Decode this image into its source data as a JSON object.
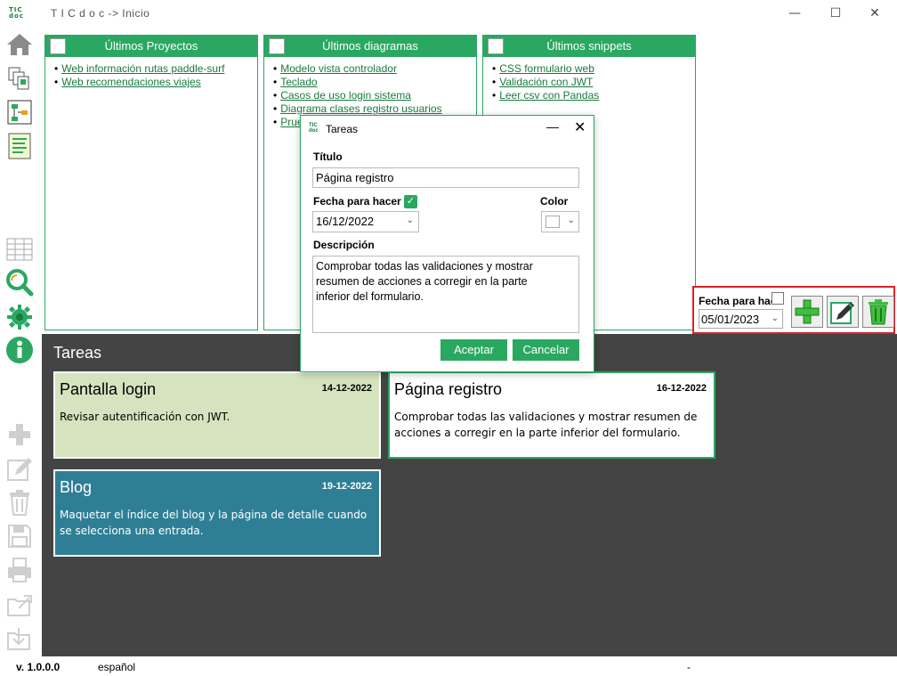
{
  "app": {
    "logo_top": "TIC",
    "logo_bottom": "doc",
    "title": "T I C d o c -> Inicio"
  },
  "panels": [
    {
      "title": "Últimos Proyectos",
      "items": [
        "Web información rutas paddle-surf",
        "Web recomendaciones viajes"
      ]
    },
    {
      "title": "Últimos diagramas",
      "items": [
        "Modelo vista controlador",
        "Teclado",
        "Casos de uso login sistema",
        "Diagrama clases registro usuarios",
        "Prue"
      ]
    },
    {
      "title": "Últimos snippets",
      "items": [
        "CSS formulario web",
        "Validación con JWT",
        "Leer csv con Pandas"
      ]
    }
  ],
  "tasks": {
    "heading": "Tareas",
    "cards": [
      {
        "title": "Pantalla login",
        "date": "14-12-2022",
        "desc": "Revisar autentificación con JWT.",
        "bg": "#d5e3bf",
        "fg": "#000000"
      },
      {
        "title": "Página registro",
        "date": "16-12-2022",
        "desc": "Comprobar todas las validaciones y mostrar resumen de acciones a corregir en la parte inferior del formulario.",
        "bg": "#ffffff",
        "fg": "#000000"
      },
      {
        "title": "Blog",
        "date": "19-12-2022",
        "desc": "Maquetar el índice del blog y la página de detalle cuando se selecciona una entrada.",
        "bg": "#2e7f96",
        "fg": "#ffffff"
      }
    ]
  },
  "filter": {
    "label": "Fecha para hac",
    "date": "05/01/2023"
  },
  "dialog": {
    "logo_top": "TIC",
    "logo_bottom": "doc",
    "title": "Tareas",
    "titulo_label": "Título",
    "titulo_value": "Página registro",
    "fecha_label": "Fecha para hacer",
    "fecha_value": "16/12/2022",
    "color_label": "Color",
    "desc_label": "Descripción",
    "desc_value": "Comprobar todas las validaciones y mostrar resumen de acciones a corregir en la parte inferior del formulario.",
    "accept": "Aceptar",
    "cancel": "Cancelar"
  },
  "status": {
    "version": "v. 1.0.0.0",
    "language": "español",
    "right": "-"
  },
  "colors": {
    "accent": "#2aa862",
    "dark_bg": "#444444",
    "highlight": "#e01e2a"
  }
}
